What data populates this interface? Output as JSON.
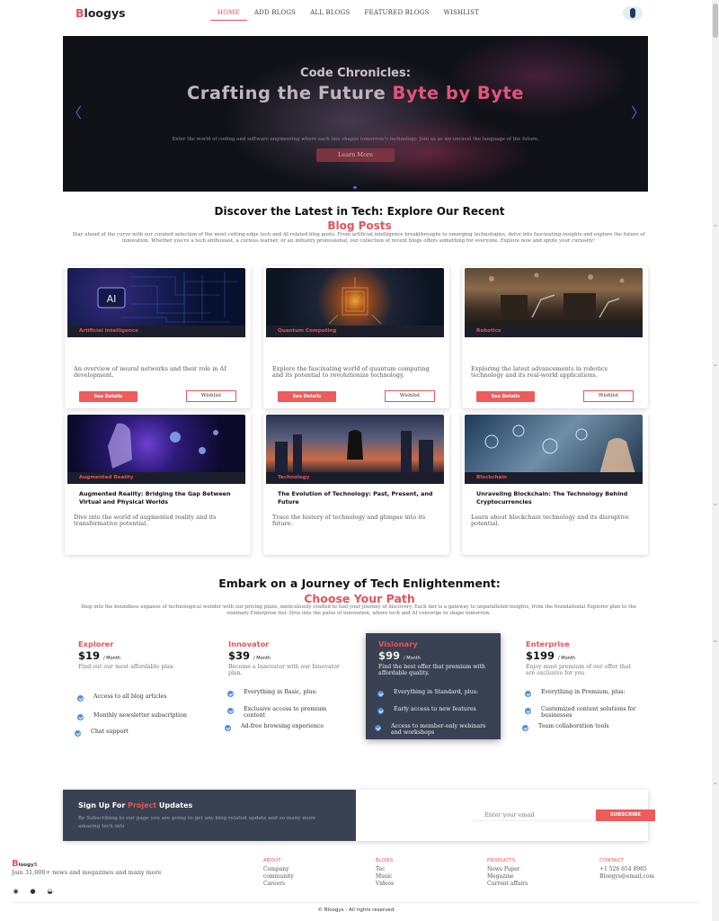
{
  "nav": {
    "logo_first": "B",
    "logo_rest": "loogys",
    "links": [
      "HOME",
      "ADD BLOGS",
      "ALL BLOGS",
      "FEATURED BLOGS",
      "WISHLIST"
    ]
  },
  "hero": {
    "kicker": "Code Chronicles:",
    "title_main": "Crafting the Future ",
    "title_highlight": "Byte by Byte",
    "description": "Enter the world of coding and software engineering where each line shapes tomorrow's technology. Join us as we unravel the language of the future.",
    "button": "Learn More",
    "prev_arrow": "〈",
    "next_arrow": "〉"
  },
  "recent": {
    "heading": "Discover the Latest in Tech: Explore Our Recent",
    "subheading": "Blog Posts",
    "paragraph": "Stay ahead of the curve with our curated selection of the most cutting-edge tech and AI-related blog posts. From artificial intelligence breakthroughs to emerging technologies, delve into fascinating insights and explore the future of innovation. Whether you're a tech enthusiast, a curious learner, or an industry professional, our collection of recent blogs offers something for everyone. Explore now and ignite your curiosity!"
  },
  "cards": [
    {
      "category": "Artificial Intelligence",
      "title": "",
      "description": "An overview of neural networks and their role in AI development.",
      "details_btn": "See Details",
      "wishlist_btn": "Wishlist"
    },
    {
      "category": "Quantum Computing",
      "title": "",
      "description": "Explore the fascinating world of quantum computing and its potential to revolutionize technology.",
      "details_btn": "See Details",
      "wishlist_btn": "Wishlist"
    },
    {
      "category": "Robotics",
      "title": "",
      "description": "Exploring the latest advancements in robotics technology and its real-world applications.",
      "details_btn": "See Details",
      "wishlist_btn": "Wishlist"
    },
    {
      "category": "Augmented Reality",
      "title": "Augmented Reality: Bridging the Gap Between Virtual and Physical Worlds",
      "description": "Dive into the world of augmented reality and its transformative potential."
    },
    {
      "category": "Technology",
      "title": "The Evolution of Technology: Past, Present, and Future",
      "description": "Trace the history of technology and glimpse into its future."
    },
    {
      "category": "Blockchain",
      "title": "Unraveling Blockchain: The Technology Behind Cryptocurrencies",
      "description": "Learn about blockchain technology and its disruptive potential."
    }
  ],
  "pricing": {
    "heading": "Embark on a Journey of Tech Enlightenment:",
    "subheading": "Choose Your Path",
    "paragraph": "Step into the boundless expanse of technological wonder with our pricing plans, meticulously crafted to fuel your journey of discovery. Each tier is a gateway to unparalleled insights, from the foundational Explorer plan to the visionary Enterprise tier. Dive into the pulse of innovation, where tech and AI converge to shape tomorrow.",
    "plans": [
      {
        "name": "Explorer",
        "price": "$19",
        "period": "/ Month",
        "description": "Find out our most affordable plan",
        "features": [
          "Access to all blog articles",
          "Monthly newsletter subscription",
          "Chat support"
        ]
      },
      {
        "name": "Innovator",
        "price": "$39",
        "period": "/ Month",
        "description": "Become a Innovator with our Innovator plan.",
        "features": [
          "Everything in Basic, plus:",
          "Exclusive access to premium content",
          "Ad-free browsing experience"
        ]
      },
      {
        "name": "Visionary",
        "price": "$99",
        "period": "/ Month",
        "description": "Find the best offer that premium with affordable quality.",
        "features": [
          "Everything in Standard, plus:",
          "Early access to new features",
          "Access to member-only webinars and workshops"
        ]
      },
      {
        "name": "Enterprise",
        "price": "$199",
        "period": "/ Month",
        "description": "Enjoy most premium of our offer that are exclusive for you",
        "features": [
          "Everything in Premium, plus:",
          "Customized content solutions for businesses",
          "Team collaboration tools"
        ]
      }
    ]
  },
  "signup": {
    "title_pre": "Sign Up For ",
    "title_hl": "Project",
    "title_post": " Updates",
    "description": "By Subscribing to our page you are going to get any blog related update and so many more amazing tech info",
    "email_placeholder": "Enter your email",
    "button": "SUBSCRIBE"
  },
  "footer": {
    "logo_first": "B",
    "logo_mid": "loogy",
    "logo_s": "s",
    "tagline": "Join 31,000+ news and megazines and many more",
    "columns": [
      {
        "heading": "ABOUT",
        "items": [
          "Company",
          "community",
          "Careers"
        ]
      },
      {
        "heading": "BLOGS",
        "items": [
          "Tec",
          "Music",
          "Videos"
        ]
      },
      {
        "heading": "PRODUCTS",
        "items": [
          "News Paper",
          "Megazine",
          "Current affairs"
        ]
      },
      {
        "heading": "CONTACT",
        "items": [
          "+1 526 654 8965",
          "Bloogys@email.com"
        ]
      }
    ],
    "copyright": "© Bloogys - All rights reserved"
  }
}
